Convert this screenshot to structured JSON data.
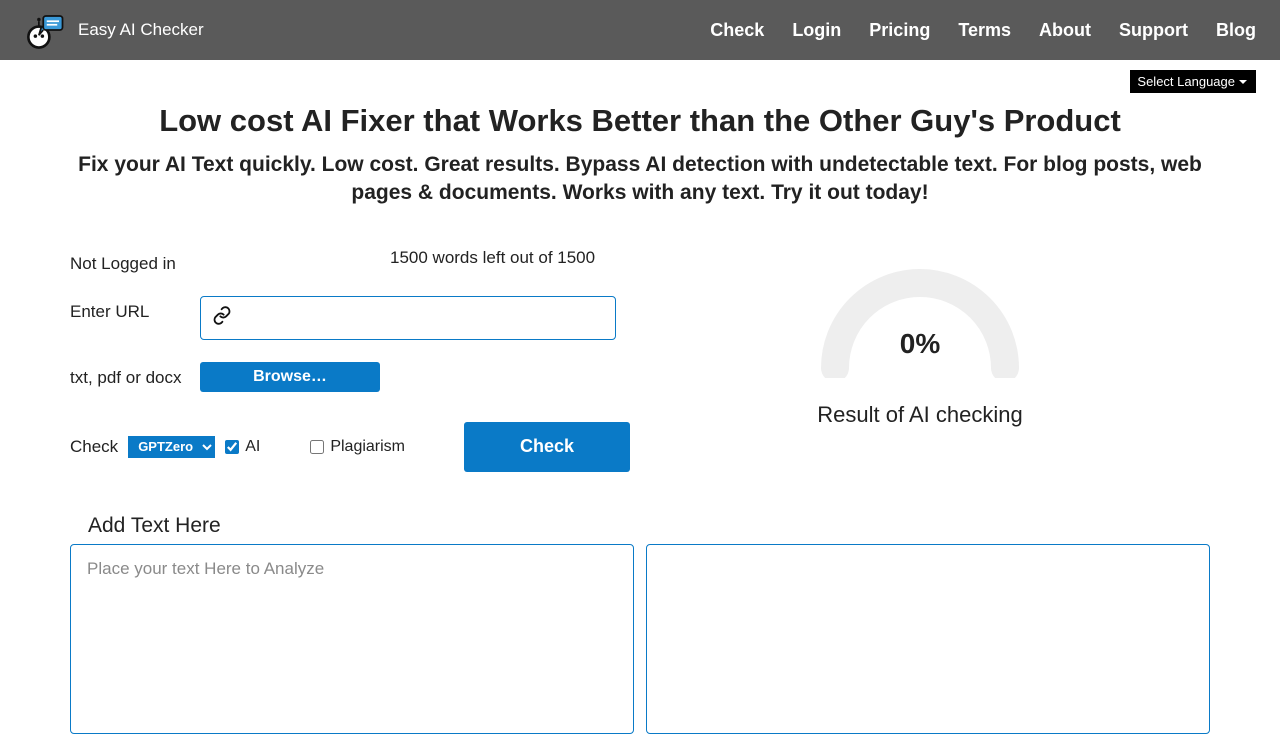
{
  "brand": "Easy AI Checker",
  "nav": [
    "Check",
    "Login",
    "Pricing",
    "Terms",
    "About",
    "Support",
    "Blog"
  ],
  "language_selector": "Select Language",
  "heading": "Low cost AI Fixer that Works Better than the Other Guy's Product",
  "subheading": "Fix your AI Text quickly. Low cost. Great results. Bypass AI detection with undetectable text. For blog posts, web pages & documents. Works with any text. Try it out today!",
  "login_status": "Not Logged in",
  "words_left": "1500 words left out of 1500",
  "url_label": "Enter URL",
  "url_value": "",
  "file_label": "txt, pdf or docx",
  "browse_label": "Browse…",
  "check_label": "Check",
  "detector_selected": "GPTZero",
  "ai_label": "AI",
  "ai_checked": true,
  "plagiarism_label": "Plagiarism",
  "plagiarism_checked": false,
  "check_button": "Check",
  "gauge_value": "0%",
  "gauge_caption": "Result of AI checking",
  "add_text_label": "Add Text Here",
  "textarea_placeholder": "Place your text Here to Analyze",
  "textarea_value": ""
}
